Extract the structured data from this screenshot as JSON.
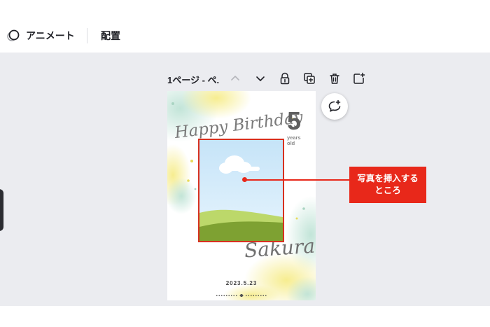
{
  "toolbar": {
    "animate_label": "アニメート",
    "arrange_label": "配置"
  },
  "page_controls": {
    "page_label": "1ページ - ペ."
  },
  "card": {
    "title_script": "Happy Birthday",
    "age_number": "5",
    "age_unit_line1": "years",
    "age_unit_line2": "old",
    "name_script": "Sakura",
    "date": "2023.5.23"
  },
  "annotation": {
    "line1": "写真を挿入する",
    "line2": "ところ"
  },
  "colors": {
    "accent_red": "#e8281a",
    "canvas_bg": "#ebecf0"
  }
}
